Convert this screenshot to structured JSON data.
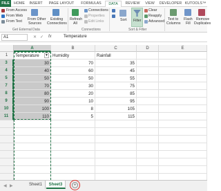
{
  "ribbon_tabs": [
    "FILE",
    "HOME",
    "INSERT",
    "PAGE LAYOUT",
    "FORMULAS",
    "DATA",
    "REVIEW",
    "VIEW",
    "DEVELOPER",
    "KUTOOLS"
  ],
  "ribbon_more": "KUTOOLS™",
  "active_tab": "DATA",
  "get_external": {
    "from_access": "From Access",
    "from_web": "From Web",
    "from_text": "From Text",
    "from_other": "From Other",
    "sources": "Sources",
    "existing": "Existing",
    "connections": "Connections",
    "group_label": "Get External Data"
  },
  "connections": {
    "refresh": "Refresh",
    "all": "All",
    "connections": "Connections",
    "properties": "Properties",
    "edit_links": "Edit Links",
    "group_label": "Connections"
  },
  "sort_filter": {
    "sort": "Sort",
    "filter": "Filter",
    "clear": "Clear",
    "reapply": "Reapply",
    "advanced": "Advanced",
    "group_label": "Sort & Filter"
  },
  "data_tools": {
    "text_to": "Text to",
    "columns": "Columns",
    "flash": "Flash",
    "fill": "Fill",
    "remove": "Remove",
    "duplicates": "Duplicates"
  },
  "formula_bar": {
    "name_box": "A1",
    "fx": "fx",
    "value": "Temperature"
  },
  "columns": [
    "A",
    "B",
    "C",
    "D",
    "E"
  ],
  "rows": [
    {
      "num": "1",
      "a": "Temperature",
      "b": "Humidity",
      "c": "Rainfall"
    },
    {
      "num": "3",
      "a": "30",
      "b": "70",
      "c": "35"
    },
    {
      "num": "4",
      "a": "40",
      "b": "60",
      "c": "45"
    },
    {
      "num": "5",
      "a": "50",
      "b": "50",
      "c": "55"
    },
    {
      "num": "7",
      "a": "70",
      "b": "30",
      "c": "75"
    },
    {
      "num": "8",
      "a": "80",
      "b": "20",
      "c": "85"
    },
    {
      "num": "9",
      "a": "90",
      "b": "10",
      "c": "95"
    },
    {
      "num": "10",
      "a": "100",
      "b": "8",
      "c": "105"
    },
    {
      "num": "11",
      "a": "110",
      "b": "5",
      "c": "115"
    },
    {
      "num": "",
      "a": "",
      "b": "",
      "c": ""
    },
    {
      "num": "",
      "a": "",
      "b": "",
      "c": ""
    },
    {
      "num": "",
      "a": "",
      "b": "",
      "c": ""
    },
    {
      "num": "",
      "a": "",
      "b": "",
      "c": ""
    },
    {
      "num": "",
      "a": "",
      "b": "",
      "c": ""
    },
    {
      "num": "",
      "a": "",
      "b": "",
      "c": ""
    },
    {
      "num": "",
      "a": "",
      "b": "",
      "c": ""
    },
    {
      "num": "",
      "a": "",
      "b": "",
      "c": ""
    }
  ],
  "filter_arrow": "▼",
  "sheets": [
    "Sheet1",
    "Sheet3"
  ],
  "active_sheet": "Sheet3",
  "add_sheet": "+",
  "colors": {
    "accent": "#217346",
    "highlight": "#d9302c",
    "selection": "#c9c9c9"
  }
}
